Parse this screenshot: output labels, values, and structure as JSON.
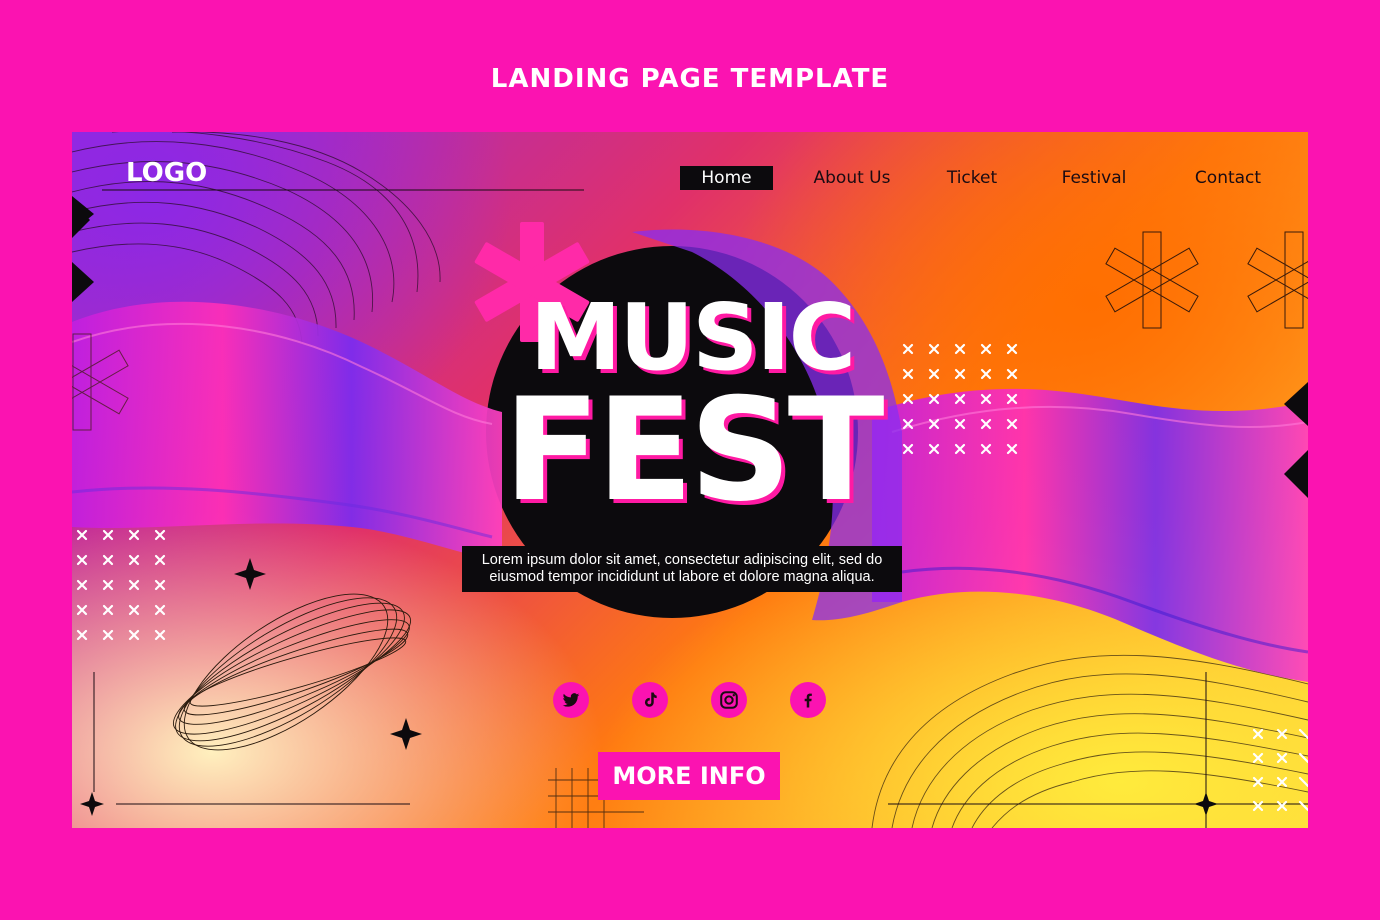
{
  "page_heading": "LANDING PAGE TEMPLATE",
  "header": {
    "logo": "LOGO",
    "nav": [
      "Home",
      "About Us",
      "Ticket",
      "Festival",
      "Contact"
    ],
    "active_nav": "Home"
  },
  "hero": {
    "title_line1": "MUSIC",
    "title_line2": "FEST",
    "description": "Lorem ipsum dolor sit amet, consectetur adipiscing elit, sed do eiusmod tempor incididunt ut labore et dolore magna aliqua."
  },
  "social_icons": [
    "twitter-icon",
    "tiktok-icon",
    "instagram-icon",
    "facebook-icon"
  ],
  "cta": {
    "label": "MORE INFO"
  },
  "colors": {
    "background": "#fb13b1",
    "accent": "#ff1aa3",
    "dark": "#0c0a0d",
    "white": "#ffffff"
  }
}
